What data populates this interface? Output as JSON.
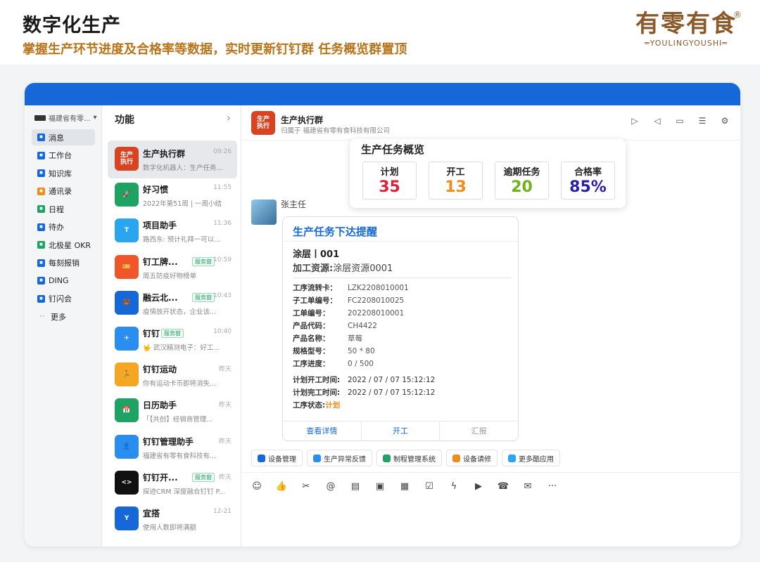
{
  "header": {
    "title": "数字化生产",
    "subtitle": "掌握生产环节进度及合格率等数据，实时更新钉钉群 任务概览群置顶"
  },
  "brand": {
    "cn": "有零有食",
    "en": "═YOULINGYOUSHI═",
    "reg": "®"
  },
  "colors": {
    "accent": "#1668d9",
    "brand": "#8b5a2b",
    "subtitle": "#b8741a"
  },
  "nav": {
    "org": "福建省有零...",
    "items": [
      {
        "label": "消息",
        "icon": "message-icon",
        "color": "#1668d9"
      },
      {
        "label": "工作台",
        "icon": "workbench-icon",
        "color": "#1668d9"
      },
      {
        "label": "知识库",
        "icon": "knowledge-icon",
        "color": "#1668d9"
      },
      {
        "label": "通讯录",
        "icon": "contacts-icon",
        "color": "#f08c1a"
      },
      {
        "label": "日程",
        "icon": "calendar-icon",
        "color": "#1ea362"
      },
      {
        "label": "待办",
        "icon": "todo-icon",
        "color": "#1668d9"
      },
      {
        "label": "北极星 OKR",
        "icon": "okr-icon",
        "color": "#1ea362"
      },
      {
        "label": "每刻报销",
        "icon": "expense-icon",
        "color": "#1668d9"
      },
      {
        "label": "DING",
        "icon": "ding-icon",
        "color": "#1668d9"
      },
      {
        "label": "钉闪会",
        "icon": "meeting-icon",
        "color": "#1668d9"
      },
      {
        "label": "更多",
        "icon": "more-icon",
        "color": ""
      }
    ]
  },
  "list": {
    "head": "功能",
    "convs": [
      {
        "name": "生产执行群",
        "time": "09:26",
        "preview": "数字化机器人：生产任务...",
        "avatar": "生产\n执行",
        "color": "#d9431f",
        "badge": ""
      },
      {
        "name": "好习惯",
        "time": "11:55",
        "preview": "2022年第51周 | 一周小结",
        "avatar": "🚀",
        "color": "#1ea362",
        "badge": ""
      },
      {
        "name": "项目助手",
        "time": "11:36",
        "preview": "路西东: 预计礼拜一可以...",
        "avatar": "T",
        "color": "#2aa5f0",
        "badge": ""
      },
      {
        "name": "钉工牌...",
        "time": "10:59",
        "preview": "周五防疫好物榜单",
        "avatar": "🎫",
        "color": "#f0562a",
        "badge": "服务窗"
      },
      {
        "name": "融云北...",
        "time": "10:43",
        "preview": "疫情放开状态，企业该...",
        "avatar": "🐻",
        "color": "#1668d9",
        "badge": "服务窗"
      },
      {
        "name": "钉钉",
        "time": "10:40",
        "preview": "🤟 武汉精测电子：好工...",
        "avatar": "✈",
        "color": "#2a8ef0",
        "badge": "服务窗"
      },
      {
        "name": "钉钉运动",
        "time": "昨天",
        "preview": "你有运动卡币即将消失...",
        "avatar": "🏃",
        "color": "#f5a623",
        "badge": ""
      },
      {
        "name": "日历助手",
        "time": "昨天",
        "preview": "「【共创】经销商管理...",
        "avatar": "📅",
        "color": "#1ea362",
        "badge": ""
      },
      {
        "name": "钉钉管理助手",
        "time": "昨天",
        "preview": "福建省有零有食科技有...",
        "avatar": "👤",
        "color": "#2a8ef0",
        "badge": ""
      },
      {
        "name": "钉钉开...",
        "time": "昨天",
        "preview": "探迹CRM 深度融合钉钉 P...",
        "avatar": "<>",
        "color": "#111",
        "badge": "服务窗"
      },
      {
        "name": "宜搭",
        "time": "12-21",
        "preview": "使用人数即将满额",
        "avatar": "Y",
        "color": "#1668d9",
        "badge": ""
      }
    ]
  },
  "chat": {
    "avatar": "生产\n执行",
    "name": "生产执行群",
    "sub": "归属于 福建省有零有食科技有限公司",
    "header_icons": [
      "video-icon",
      "volume-icon",
      "folder-icon",
      "search-list-icon",
      "settings-icon"
    ]
  },
  "overview": {
    "title": "生产任务概览",
    "stats": [
      {
        "label": "计划",
        "value": "35",
        "color": "#d8233a"
      },
      {
        "label": "开工",
        "value": "13",
        "color": "#f08c1a"
      },
      {
        "label": "逾期任务",
        "value": "20",
        "color": "#6fb21a"
      },
      {
        "label": "合格率",
        "value": "85%",
        "color": "#2a1fa8"
      }
    ]
  },
  "message": {
    "sender": "张主任",
    "card": {
      "title": "生产任务下达提醒",
      "h1": "涂层丨001",
      "h2_key": "加工资源:",
      "h2_val": "涂层资源0001",
      "fields": [
        {
          "k": "工序流转卡：",
          "v": "LZK2208010001"
        },
        {
          "k": "子工单编号：",
          "v": "FC2208010025"
        },
        {
          "k": "工单编号：",
          "v": "202208010001"
        },
        {
          "k": "产品代码：",
          "v": "CH4422"
        },
        {
          "k": "产品名称：",
          "v": "草莓"
        },
        {
          "k": "规格型号：",
          "v": "50 * 80"
        },
        {
          "k": "工序进度：",
          "v": "0 / 500"
        }
      ],
      "times": [
        {
          "k": "计划开工时间:",
          "v": "2022 / 07 / 07 15:12:12"
        },
        {
          "k": "计划完工时间:",
          "v": "2022 / 07 / 07 15:12:12"
        }
      ],
      "status_k": "工序状态:",
      "status_v": "计划",
      "actions": [
        "查看详情",
        "开工",
        "汇报"
      ]
    }
  },
  "quick": [
    {
      "label": "设备管理",
      "color": "#1668d9"
    },
    {
      "label": "生产异常反馈",
      "color": "#2a8ef0"
    },
    {
      "label": "制程管理系统",
      "color": "#1ea362"
    },
    {
      "label": "设备请修",
      "color": "#f08c1a"
    },
    {
      "label": "更多酷应用",
      "color": "#2aa5f0"
    }
  ],
  "toolbar": [
    "emoji-icon",
    "thumbs-up-icon",
    "scissors-icon",
    "at-icon",
    "doc-add-icon",
    "folder-upload-icon",
    "calendar-22-icon",
    "check-square-icon",
    "flash-icon",
    "live-icon",
    "phone-icon",
    "mail-icon",
    "more-icon"
  ]
}
